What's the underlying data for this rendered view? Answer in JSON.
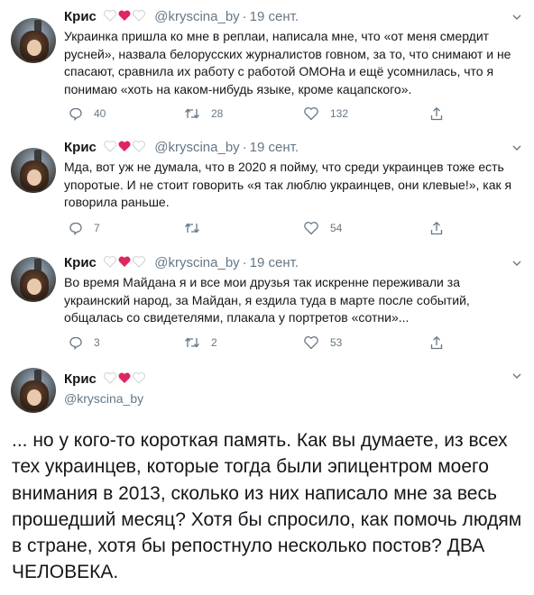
{
  "tweets": [
    {
      "name": "Крис",
      "handle": "@kryscina_by",
      "date": "19 сент.",
      "text": "Украинка пришла ко мне в реплаи, написала мне, что «от меня смердит русней», назвала белорусских журналистов говном, за то, что снимают и не спасают, сравнила их работу с работой ОМОНа и ещё усомнилась, что я понимаю «хоть на каком-нибудь языке, кроме кацапского».",
      "replies": "40",
      "retweets": "28",
      "likes": "132"
    },
    {
      "name": "Крис",
      "handle": "@kryscina_by",
      "date": "19 сент.",
      "text": "Мда, вот уж не думала, что в 2020 я пойму, что среди украинцев тоже есть упоротые. И не стоит говорить «я так люблю украинцев, они клевые!», как я говорила раньше.",
      "replies": "7",
      "retweets": "",
      "likes": "54"
    },
    {
      "name": "Крис",
      "handle": "@kryscina_by",
      "date": "19 сент.",
      "text": "Во время Майдана я и все мои друзья так искренне переживали за украинский народ, за Майдан, я ездила туда в марте после событий, общалась со свидетелями, плакала у портретов «сотни»...",
      "replies": "3",
      "retweets": "2",
      "likes": "53"
    }
  ],
  "main_tweet": {
    "name": "Крис",
    "handle": "@kryscina_by",
    "text": "... но у кого-то короткая память. Как вы думаете, из всех тех украинцев, которые тогда были эпицентром моего внимания в 2013, сколько из них написало мне за весь прошедший месяц? Хотя бы спросило, как помочь людям в стране, хотя бы репостнуло несколько постов? ДВА ЧЕЛОВЕКА."
  },
  "colors": {
    "text": "#14171a",
    "secondary": "#657786",
    "heart_red": "#e0245e",
    "heart_white_outline": "#d9d9d9"
  },
  "icons": [
    "reply-icon",
    "retweet-icon",
    "like-icon",
    "share-icon",
    "chevron-down-icon",
    "heart-emoji-icon"
  ]
}
